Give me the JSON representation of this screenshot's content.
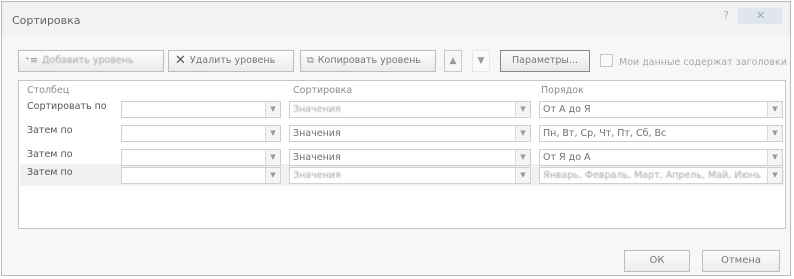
{
  "window": {
    "title": "Сортировка"
  },
  "toolbar": {
    "add_level": "Добавить уровень",
    "delete_level": "Удалить уровень",
    "copy_level": "Копировать уровень",
    "move_up_arrow": "▲",
    "move_down_arrow": "▼",
    "params": "Параметры...",
    "headers_checkbox": "Мои данные содержат заголовки",
    "headers_checked": false
  },
  "grid": {
    "headers": {
      "column": "Столбец",
      "sort": "Сортировка",
      "order": "Порядок"
    },
    "rows": [
      {
        "label": "Сортировать по",
        "column": "",
        "sort": "Значения",
        "order": "От А до Я"
      },
      {
        "label": "Затем по",
        "column": "",
        "sort": "Значения",
        "order": "Пн, Вт, Ср, Чт, Пт, Сб, Вс"
      },
      {
        "label": "Затем по",
        "column": "",
        "sort": "Значения",
        "order": "От Я до А"
      },
      {
        "label": "Затем по",
        "column": "",
        "sort": "Значения",
        "order": "Январь, Февраль, Март, Апрель, Май, Июнь"
      }
    ]
  },
  "footer": {
    "ok": "ОК",
    "cancel": "Отмена"
  }
}
